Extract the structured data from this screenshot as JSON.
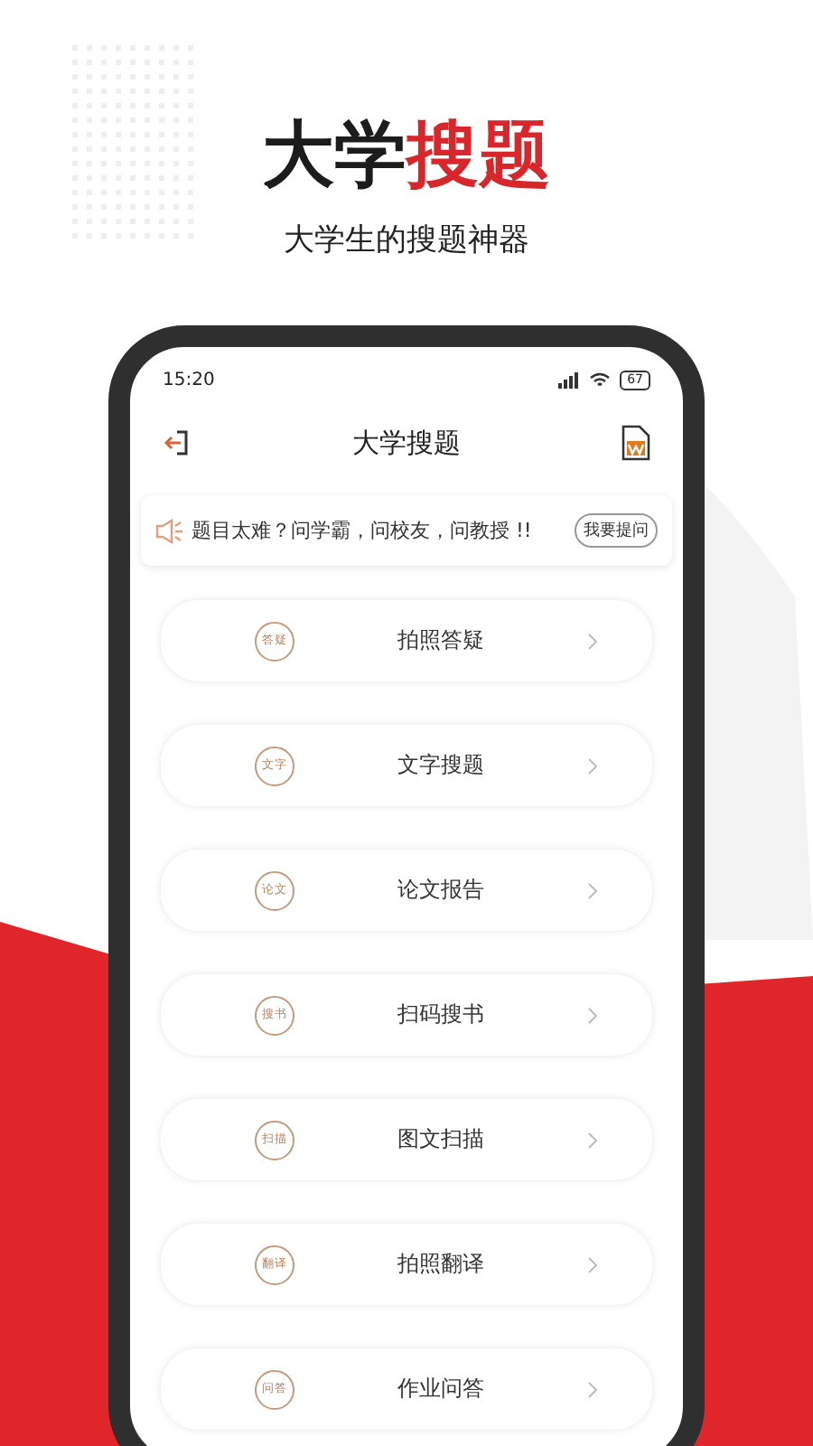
{
  "headline": {
    "plain": "大学",
    "highlight": "搜题"
  },
  "subtitle": "大学生的搜题神器",
  "status_bar": {
    "time": "15:20",
    "battery": "67"
  },
  "nav": {
    "title": "大学搜题"
  },
  "notice": {
    "text": "题目太难？问学霸，问校友，问教授 !!",
    "button": "我要提问"
  },
  "menu": [
    {
      "badge": "答疑",
      "label": "拍照答疑"
    },
    {
      "badge": "文字",
      "label": "文字搜题"
    },
    {
      "badge": "论文",
      "label": "论文报告"
    },
    {
      "badge": "搜书",
      "label": "扫码搜书"
    },
    {
      "badge": "扫描",
      "label": "图文扫描"
    },
    {
      "badge": "翻译",
      "label": "拍照翻译"
    },
    {
      "badge": "问答",
      "label": "作业问答"
    }
  ]
}
